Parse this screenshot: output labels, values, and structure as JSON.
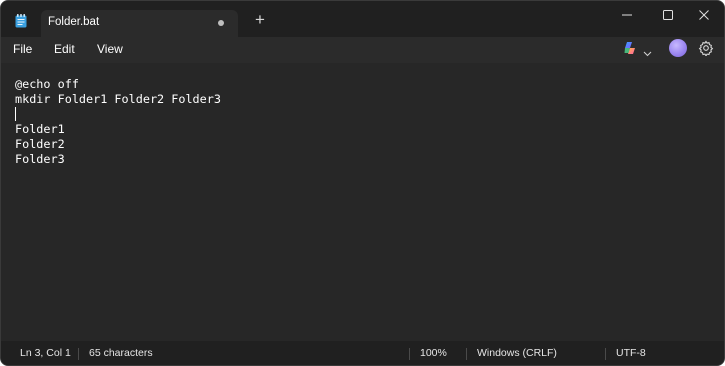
{
  "tab": {
    "title": "Folder.bat",
    "new_tab_glyph": "+"
  },
  "window_controls": {
    "minimize": "minimize-icon",
    "maximize": "maximize-icon",
    "close": "close-icon"
  },
  "menu": {
    "file": "File",
    "edit": "Edit",
    "view": "View"
  },
  "editor": {
    "lines": [
      "@echo off",
      "mkdir Folder1 Folder2 Folder3",
      "",
      "Folder1",
      "Folder2",
      "Folder3"
    ]
  },
  "status": {
    "position": "Ln 3, Col 1",
    "characters": "65 characters",
    "zoom": "100%",
    "line_ending": "Windows (CRLF)",
    "encoding": "UTF-8"
  },
  "colors": {
    "background": "#272727",
    "titlebar": "#202020",
    "text": "#ffffff"
  }
}
